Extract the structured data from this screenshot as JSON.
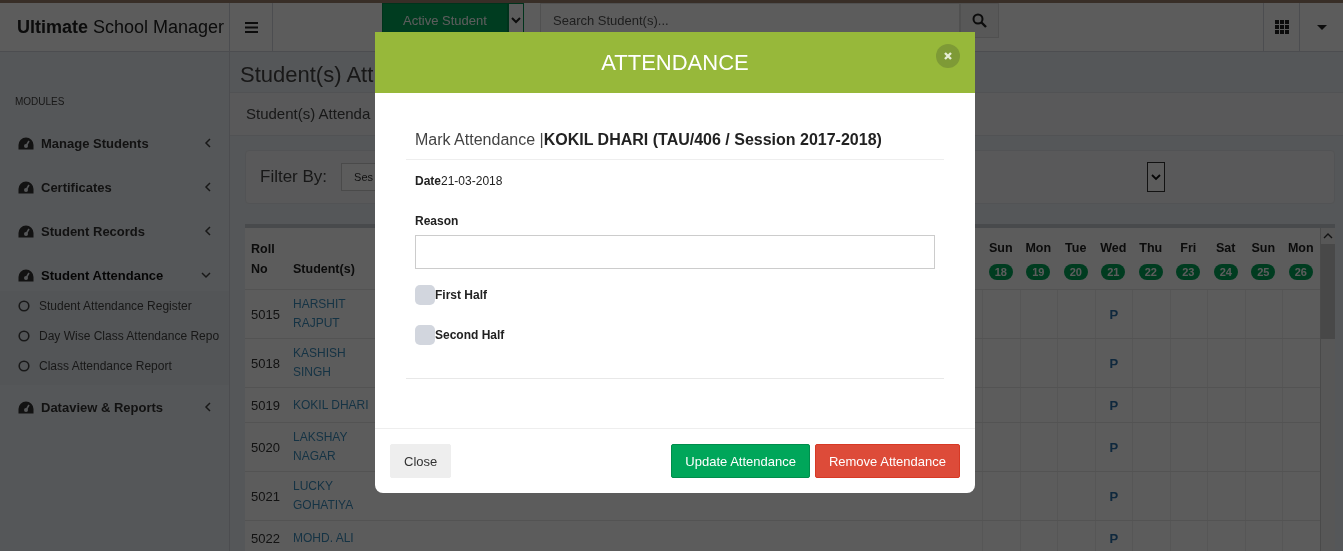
{
  "header": {
    "logo": "**Ultimate** School Manager",
    "student_filter": {
      "label": "Active Student"
    },
    "search": {
      "placeholder": "Search Student(s)..."
    }
  },
  "sidebar": {
    "heading": "MODULES",
    "items": [
      {
        "label": "Manage Students",
        "expanded": false
      },
      {
        "label": "Certificates",
        "expanded": false
      },
      {
        "label": "Student Records",
        "expanded": false
      },
      {
        "label": "Student Attendance",
        "expanded": true,
        "children": [
          {
            "label": "Student Attendance Register"
          },
          {
            "label": "Day Wise Class Attendance Repo"
          },
          {
            "label": "Class Attendance Report"
          }
        ]
      },
      {
        "label": "Dataview & Reports",
        "expanded": false
      }
    ]
  },
  "page": {
    "title": "Student(s) Att",
    "breadcrumb": "Student(s) Attenda",
    "filter": {
      "label": "Filter By:",
      "select_value": "Ses"
    }
  },
  "table": {
    "columns": [
      "Roll No",
      "Student(s)"
    ],
    "days": [
      {
        "day": "Sun",
        "date": "18"
      },
      {
        "day": "Mon",
        "date": "19"
      },
      {
        "day": "Tue",
        "date": "20"
      },
      {
        "day": "Wed",
        "date": "21",
        "marks": [
          "P",
          "P",
          "P",
          "P",
          "P",
          "P"
        ]
      },
      {
        "day": "Thu",
        "date": "22"
      },
      {
        "day": "Fri",
        "date": "23"
      },
      {
        "day": "Sat",
        "date": "24"
      },
      {
        "day": "Sun",
        "date": "25"
      },
      {
        "day": "Mon",
        "date": "26"
      }
    ],
    "rows": [
      {
        "roll": "5015",
        "name": "HARSHIT RAJPUT"
      },
      {
        "roll": "5018",
        "name": "KASHISH SINGH"
      },
      {
        "roll": "5019",
        "name": "KOKIL DHARI"
      },
      {
        "roll": "5020",
        "name": "LAKSHAY NAGAR"
      },
      {
        "roll": "5021",
        "name": "LUCKY GOHATIYA"
      },
      {
        "roll": "5022",
        "name": "MOHD. ALI"
      }
    ]
  },
  "modal": {
    "title": "ATTENDANCE",
    "heading": "Mark Attendance |**KOKIL DHARI (TAU/406 / Session 2017-2018)**",
    "date": "**Date**21-03-2018",
    "reason": {
      "label": "Reason"
    },
    "options": [
      {
        "label": "First Half",
        "checked": false
      },
      {
        "label": "Second Half",
        "checked": false
      }
    ],
    "buttons": [
      {
        "label": "Close",
        "kind": "default"
      },
      {
        "label": "Update Attendance",
        "kind": "success"
      },
      {
        "label": "Remove Attendance",
        "kind": "danger"
      }
    ]
  }
}
